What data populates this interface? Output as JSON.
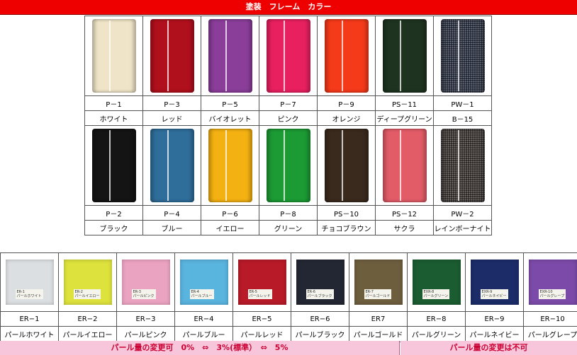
{
  "title": "塗装　フレーム　カラー",
  "frame_colors": [
    {
      "code": "P－1",
      "name": "ホワイト",
      "color": "#efe4c7"
    },
    {
      "code": "P－3",
      "name": "レッド",
      "color": "#b0101c"
    },
    {
      "code": "P－5",
      "name": "バイオレット",
      "color": "#8a3e9a"
    },
    {
      "code": "P－7",
      "name": "ピンク",
      "color": "#e8205f"
    },
    {
      "code": "P－9",
      "name": "オレンジ",
      "color": "#f53a1a"
    },
    {
      "code": "PS－11",
      "name": "ディープグリーン",
      "color": "#1e3320"
    },
    {
      "code": "PW－1",
      "name": "B－15",
      "color": "#1c2230"
    },
    {
      "code": "P－2",
      "name": "ブラック",
      "color": "#141414"
    },
    {
      "code": "P－4",
      "name": "ブルー",
      "color": "#2f6e9a"
    },
    {
      "code": "P－6",
      "name": "イエロー",
      "color": "#f3b112"
    },
    {
      "code": "P－8",
      "name": "グリーン",
      "color": "#1c9a34"
    },
    {
      "code": "PS－10",
      "name": "チョコブラウン",
      "color": "#3a2a1d"
    },
    {
      "code": "PS－12",
      "name": "サクラ",
      "color": "#e25c68"
    },
    {
      "code": "PW－2",
      "name": "レインボーナイト",
      "color": "#2a241f"
    }
  ],
  "pearl_colors": [
    {
      "code": "ER−1",
      "name": "パールホワイト",
      "color": "#dcdfe2",
      "label": "ER-1\nパールホワイト"
    },
    {
      "code": "ER−2",
      "name": "パールイエロー",
      "color": "#dde23c",
      "label": "ER-2\nパールイエロー"
    },
    {
      "code": "ER−3",
      "name": "パールピンク",
      "color": "#eba3c2",
      "label": "ER-3\nパールピンク"
    },
    {
      "code": "ER−4",
      "name": "パールブルー",
      "color": "#59b4de",
      "label": "ER-4\nパールブルー"
    },
    {
      "code": "ER−5",
      "name": "パールレッド",
      "color": "#b81a28",
      "label": "ER-5\nパールレッド"
    },
    {
      "code": "ER−6",
      "name": "パールブラック",
      "color": "#232733",
      "label": "ER-6\nパールブラック"
    },
    {
      "code": "ER7",
      "name": "パールゴールド",
      "color": "#6d5e3e",
      "label": "ER-7\nパールゴールド"
    },
    {
      "code": "ER−8",
      "name": "パールグリーン",
      "color": "#1b5c30",
      "label": "EXR-8\nパールグリーン"
    },
    {
      "code": "ER−9",
      "name": "パールネイビー",
      "color": "#1b2c68",
      "label": "EXR-9\nパールネイビー"
    },
    {
      "code": "ER−10",
      "name": "パールグレープ",
      "color": "#7c4aa8",
      "label": "EXR-10\nパールグレープ"
    }
  ],
  "notes": {
    "left": "パール量の変更可　0%　⇔　3%(標準）　⇔　5%",
    "right": "パール量の変更は不可"
  }
}
